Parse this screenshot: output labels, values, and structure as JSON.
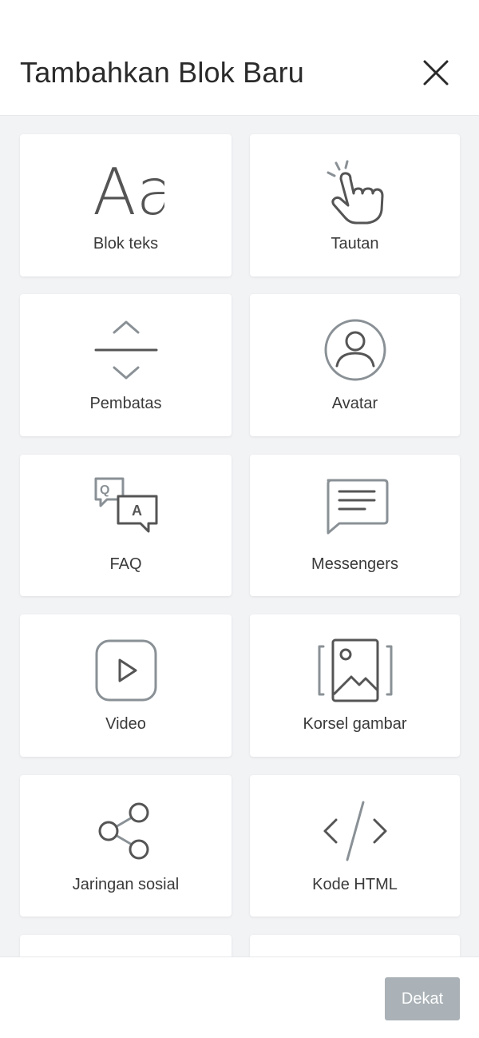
{
  "header": {
    "title": "Tambahkan Blok Baru",
    "close_icon": "close-icon"
  },
  "blocks": [
    {
      "label": "Blok teks",
      "icon": "text-icon",
      "icon_text": "Aa"
    },
    {
      "label": "Tautan",
      "icon": "tap-hand-icon"
    },
    {
      "label": "Pembatas",
      "icon": "divider-icon"
    },
    {
      "label": "Avatar",
      "icon": "avatar-icon"
    },
    {
      "label": "FAQ",
      "icon": "faq-icon",
      "q_text": "Q",
      "a_text": "A"
    },
    {
      "label": "Messengers",
      "icon": "message-icon"
    },
    {
      "label": "Video",
      "icon": "video-play-icon"
    },
    {
      "label": "Korsel gambar",
      "icon": "image-carousel-icon"
    },
    {
      "label": "Jaringan sosial",
      "icon": "share-icon"
    },
    {
      "label": "Kode HTML",
      "icon": "code-icon"
    }
  ],
  "footer": {
    "close_button_label": "Dekat"
  },
  "colors": {
    "background": "#f2f3f5",
    "card": "#ffffff",
    "icon_gray": "#8a9196",
    "icon_dark": "#4a4a4a",
    "button": "#aab2b7"
  }
}
